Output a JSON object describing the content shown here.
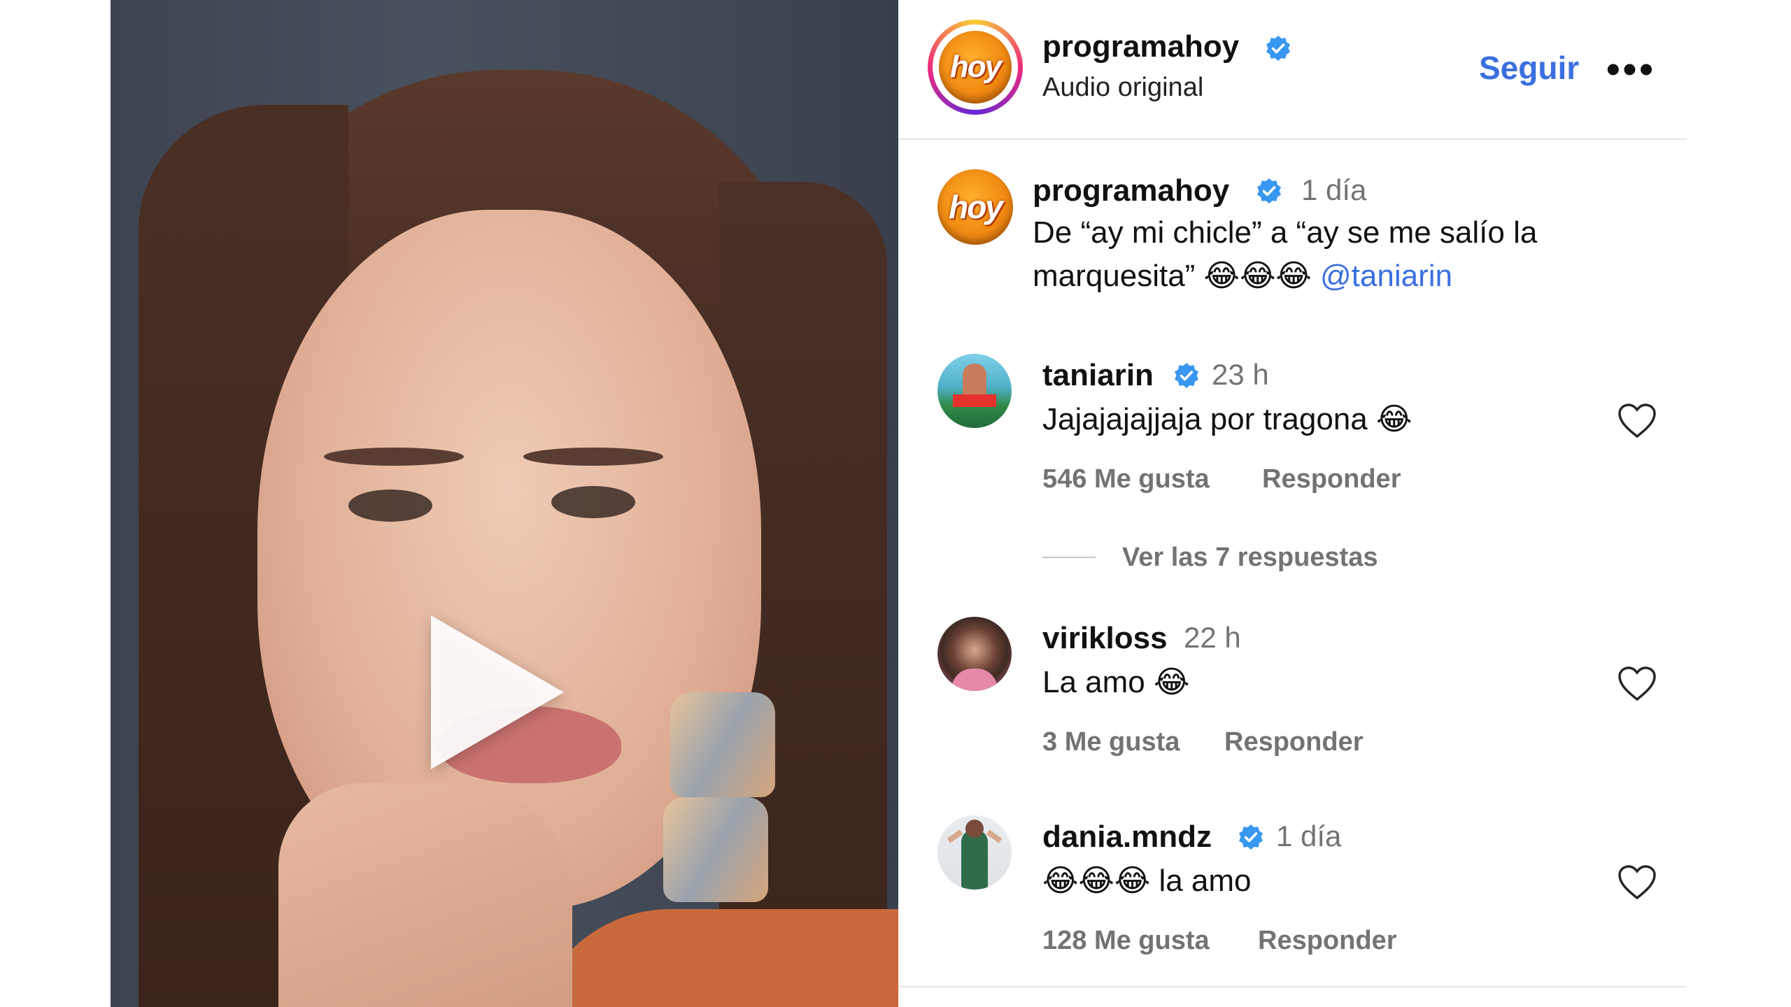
{
  "post": {
    "author": "programahoy",
    "audio_label": "Audio original",
    "follow_label": "Seguir",
    "more_label": "•••",
    "logo_text": "hoy",
    "caption_author": "programahoy",
    "caption_time": "1 día",
    "caption_line1": "De “ay mi chicle” a “ay se me salío la",
    "caption_line2": "marquesita” 😂😂😂",
    "caption_mention": "@taniarin"
  },
  "comments": [
    {
      "user": "taniarin",
      "verified": true,
      "time": "23 h",
      "text": "Jajajajajjaja por tragona 😂",
      "likes": "546 Me gusta",
      "reply_label": "Responder",
      "replies_label": "Ver las 7 respuestas"
    },
    {
      "user": "virikloss",
      "verified": false,
      "time": "22 h",
      "text": "La amo 😂",
      "likes": "3 Me gusta",
      "reply_label": "Responder"
    },
    {
      "user": "dania.mndz",
      "verified": true,
      "time": "1 día",
      "text": "😂😂😂 la amo",
      "likes": "128 Me gusta",
      "reply_label": "Responder"
    }
  ],
  "colors": {
    "accent_link": "#3b6fe0",
    "verified_badge": "#3897f0",
    "muted_text": "#737373"
  },
  "icons": {
    "play": "play-icon",
    "verified": "verified-badge-icon",
    "heart": "heart-outline-icon",
    "more": "more-horizontal-icon"
  }
}
